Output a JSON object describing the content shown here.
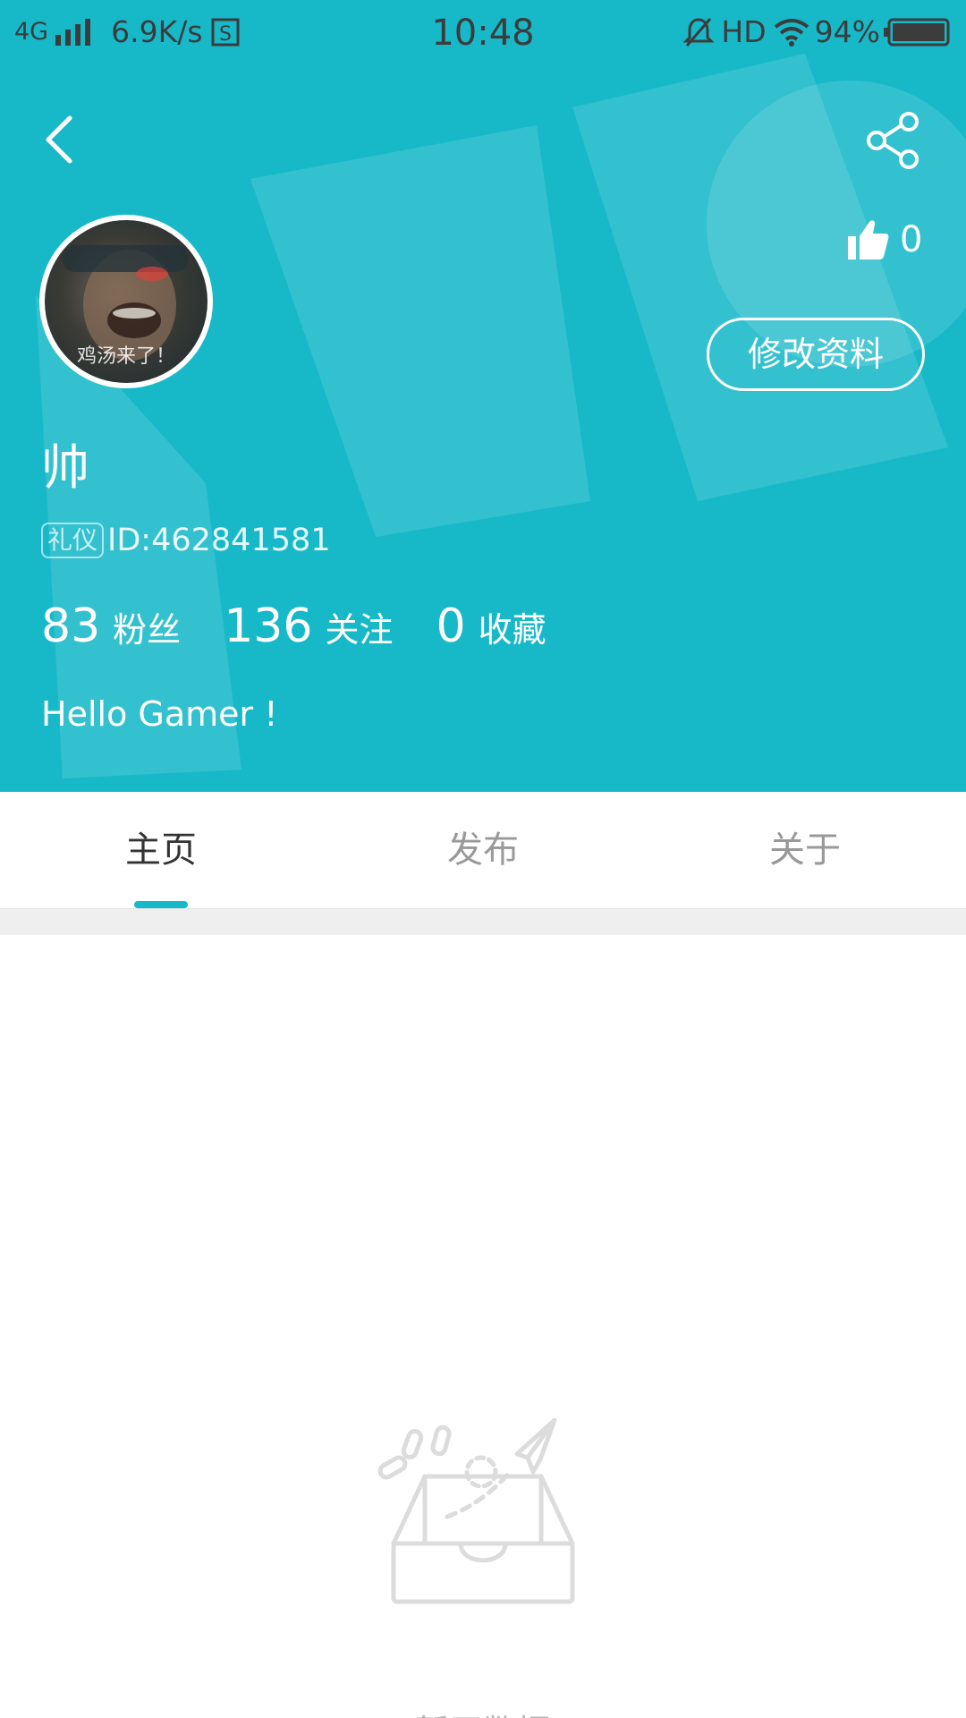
{
  "status_bar": {
    "network": "4G",
    "speed": "6.9K/s",
    "time": "10:48",
    "hd": "HD",
    "battery": "94%"
  },
  "avatar": {
    "caption": "鸡汤来了！"
  },
  "likes": {
    "count": "0"
  },
  "profile": {
    "edit_label": "修改资料",
    "username": "帅",
    "badge": "礼仪",
    "id_text": "ID:462841581",
    "bio": "Hello Gamer !"
  },
  "stats": [
    {
      "value": "83",
      "label": "粉丝"
    },
    {
      "value": "136",
      "label": "关注"
    },
    {
      "value": "0",
      "label": "收藏"
    }
  ],
  "tabs": [
    {
      "label": "主页",
      "active": true
    },
    {
      "label": "发布",
      "active": false
    },
    {
      "label": "关于",
      "active": false
    }
  ],
  "empty_state": {
    "text": "暂无数据"
  },
  "colors": {
    "accent": "#17b9c9",
    "tab_inactive": "#999999",
    "tab_active": "#333333"
  }
}
